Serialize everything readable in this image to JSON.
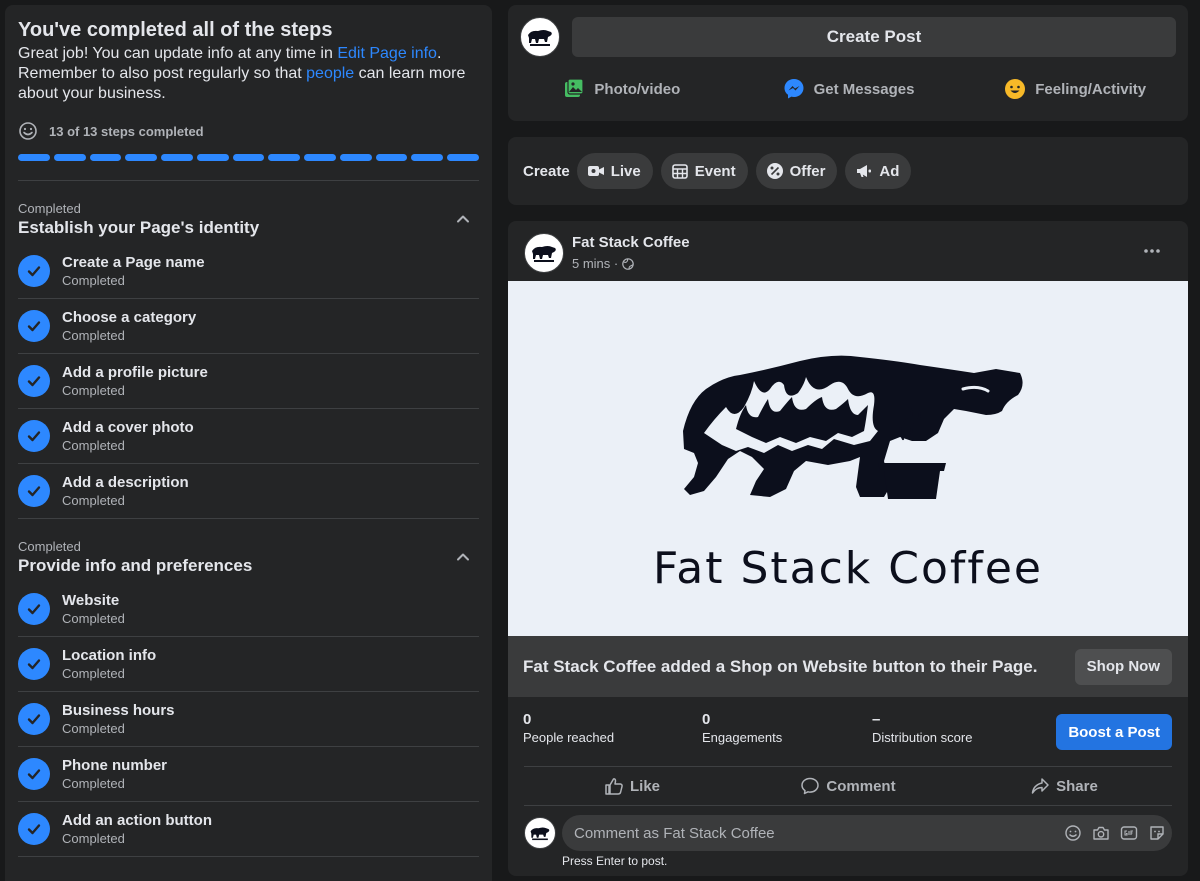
{
  "left": {
    "title": "You've completed all of the steps",
    "desc_prefix": "Great job! You can update info at any time in ",
    "desc_link1": "Edit Page info",
    "desc_mid": ". Remember to also post regularly so that ",
    "desc_link2": "people",
    "desc_suffix": " can learn more about your business.",
    "steps_count": "13 of 13 steps completed",
    "progress_total": 13,
    "progress_done": 13,
    "sections": [
      {
        "caption": "Completed",
        "title": "Establish your Page's identity",
        "steps": [
          {
            "title": "Create a Page name",
            "status": "Completed"
          },
          {
            "title": "Choose a category",
            "status": "Completed"
          },
          {
            "title": "Add a profile picture",
            "status": "Completed"
          },
          {
            "title": "Add a cover photo",
            "status": "Completed"
          },
          {
            "title": "Add a description",
            "status": "Completed"
          }
        ]
      },
      {
        "caption": "Completed",
        "title": "Provide info and preferences",
        "steps": [
          {
            "title": "Website",
            "status": "Completed"
          },
          {
            "title": "Location info",
            "status": "Completed"
          },
          {
            "title": "Business hours",
            "status": "Completed"
          },
          {
            "title": "Phone number",
            "status": "Completed"
          },
          {
            "title": "Add an action button",
            "status": "Completed"
          }
        ]
      }
    ]
  },
  "create_post": {
    "button_label": "Create Post",
    "actions": [
      {
        "label": "Photo/video",
        "icon": "photo-video-icon"
      },
      {
        "label": "Get Messages",
        "icon": "messenger-icon"
      },
      {
        "label": "Feeling/Activity",
        "icon": "feeling-icon"
      }
    ]
  },
  "create_bar": {
    "label": "Create",
    "chips": [
      {
        "label": "Live",
        "icon": "live-icon"
      },
      {
        "label": "Event",
        "icon": "event-icon"
      },
      {
        "label": "Offer",
        "icon": "offer-icon"
      },
      {
        "label": "Ad",
        "icon": "megaphone-icon"
      }
    ]
  },
  "post": {
    "author": "Fat Stack Coffee",
    "time": "5 mins ·",
    "image_text": "Fat Stack Coffee",
    "shop_text": "Fat Stack Coffee added a Shop on Website button to their Page.",
    "shop_button": "Shop Now",
    "stats": [
      {
        "value": "0",
        "label": "People reached"
      },
      {
        "value": "0",
        "label": "Engagements"
      },
      {
        "value": "–",
        "label": "Distribution score"
      }
    ],
    "boost_button": "Boost a Post",
    "reactions": [
      "Like",
      "Comment",
      "Share"
    ],
    "comment_placeholder": "Comment as Fat Stack Coffee",
    "comment_hint": "Press Enter to post."
  },
  "colors": {
    "accent": "#2d88ff",
    "background": "#18191a",
    "card": "#242526",
    "boost": "#2374e1"
  }
}
